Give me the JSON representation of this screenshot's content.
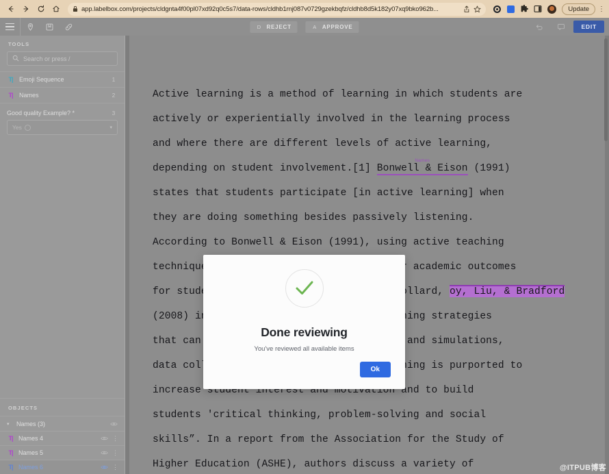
{
  "browser": {
    "url": "app.labelbox.com/projects/cldgnta4f00pl07xd92q0c5s7/data-rows/cldhb1rnj087v0729gzekbqfz/cldhb8d5k182y07xq9bko962b...",
    "back_icon": "back-arrow-icon",
    "forward_icon": "forward-arrow-icon",
    "reload_icon": "reload-icon",
    "home_icon": "home-icon",
    "lock_icon": "lock-icon",
    "share_icon": "share-icon",
    "bookmark_icon": "star-icon",
    "update_label": "Update"
  },
  "toolbar": {
    "menu_icon": "hamburger-menu-icon",
    "pin_icon": "map-pin-icon",
    "bookmark_icon": "bookmark-icon",
    "link_icon": "link-icon",
    "reject": {
      "key": "D",
      "label": "REJECT"
    },
    "approve": {
      "key": "A",
      "label": "APPROVE"
    },
    "undo_icon": "undo-icon",
    "comment_icon": "comment-icon",
    "edit_label": "EDIT"
  },
  "sidebar": {
    "tools_header": "TOOLS",
    "search": {
      "placeholder": "Search or press /"
    },
    "tools": [
      {
        "label": "Emoji Sequence",
        "badge": "1",
        "glyph": "T|",
        "color": "#3aa8c1"
      },
      {
        "label": "Names",
        "badge": "2",
        "glyph": "T|",
        "color": "#b13fd0"
      }
    ],
    "classification": {
      "label": "Good quality Example? *",
      "badge": "3",
      "value": "Yes"
    },
    "objects_header": "OBJECTS",
    "object_group": {
      "label": "Names (3)"
    },
    "objects": [
      {
        "label": "Names 4",
        "glyph": "T|",
        "color": "#b13fd0",
        "selected": false
      },
      {
        "label": "Names 5",
        "glyph": "T|",
        "color": "#b13fd0",
        "selected": false
      },
      {
        "label": "Names 6",
        "glyph": "T|",
        "color": "#5d82d6",
        "selected": true
      }
    ]
  },
  "document": {
    "paragraph_1": "Active learning is a method of learning in which students are\nactively or experientially involved in the learning process\nand where there are different levels of active learning,\ndepending on student involvement.[1] ",
    "entity_1": "Bonwell & Eison",
    "entity_1_tag": "Names",
    "after_entity_1": " (1991)\nstates that students participate [in active learning] when\nthey are doing something besides passively listening.\nAccording to Bonwell & Eison (1991), using active teaching\ntechniques in the classroom lead to better academic outcomes\nfor students. In the view of McCrindle, Pollard, ",
    "entity_2": "oy, Liu, & Bradford",
    "after_entity_2": "\n(2008) in terms of student's varying learning strategies\nthat can be built upon, such as role-play and simulations,\ndata collection and analysis, active learning is purported to\nincrease student interest and motivation and to build\nstudents 'critical thinking, problem-solving and social\nskills”. In a report from the Association for the Study of\nHigher Education (ASHE), authors discuss a variety of"
  },
  "modal": {
    "icon": "check-circle-icon",
    "title": "Done reviewing",
    "subtitle": "You've reviewed all available items",
    "ok_label": "Ok"
  },
  "watermark": {
    "text": "@ITPUB博客"
  },
  "colors": {
    "accent_blue": "#2f6ae1",
    "edit_blue": "#3a5ba8",
    "entity_purple": "#9b4fbd",
    "highlight_purple": "#b46fd0",
    "check_green": "#6cb551",
    "chrome_tan": "#e7d3b6"
  }
}
